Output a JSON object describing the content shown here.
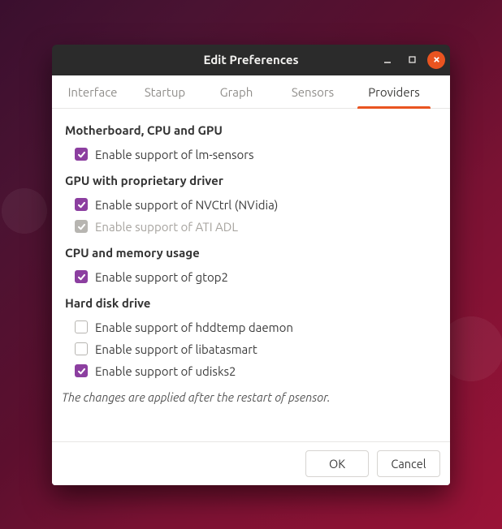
{
  "window": {
    "title": "Edit Preferences"
  },
  "tabs": {
    "items": [
      "Interface",
      "Startup",
      "Graph",
      "Sensors",
      "Providers"
    ],
    "active_index": 4
  },
  "sections": {
    "mobo": {
      "title": "Motherboard, CPU and GPU",
      "lm_sensors": {
        "label": "Enable support of lm-sensors",
        "checked": true,
        "enabled": true
      }
    },
    "gpu": {
      "title": "GPU with proprietary driver",
      "nvctrl": {
        "label": "Enable support of NVCtrl (NVidia)",
        "checked": true,
        "enabled": true
      },
      "atiadl": {
        "label": "Enable support of ATI ADL",
        "checked": true,
        "enabled": false
      }
    },
    "cpumem": {
      "title": "CPU and memory usage",
      "gtop2": {
        "label": "Enable support of gtop2",
        "checked": true,
        "enabled": true
      }
    },
    "hdd": {
      "title": "Hard disk drive",
      "hddtemp": {
        "label": "Enable support of hddtemp daemon",
        "checked": false,
        "enabled": true
      },
      "libatasmart": {
        "label": "Enable support of libatasmart",
        "checked": false,
        "enabled": true
      },
      "udisks2": {
        "label": "Enable support of udisks2",
        "checked": true,
        "enabled": true
      }
    }
  },
  "note": "The changes are applied after the restart of psensor.",
  "footer": {
    "ok": "OK",
    "cancel": "Cancel"
  },
  "colors": {
    "accent": "#e95420",
    "check": "#8c3fa0"
  }
}
